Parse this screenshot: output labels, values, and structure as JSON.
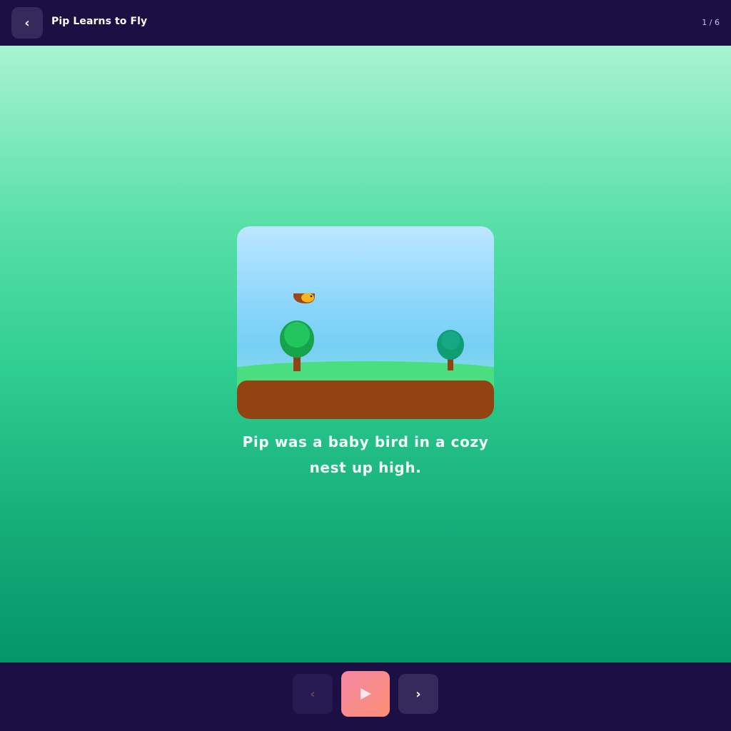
{
  "header": {
    "back_icon": "‹",
    "title": "Pip Learns to Fly",
    "page_indicator": "1 / 6"
  },
  "story": {
    "text": "Pip was a baby bird in a cozy nest up high."
  },
  "controls": {
    "prev_icon": "‹",
    "play_icon": "play-icon",
    "next_icon": "›"
  },
  "colors": {
    "bar_background": "#1b0f44",
    "button_background": "#342a5b",
    "play_gradient_start": "#f587a4",
    "play_gradient_end": "#fb8f75",
    "ground": "#924312",
    "hill": "#4ade80"
  }
}
